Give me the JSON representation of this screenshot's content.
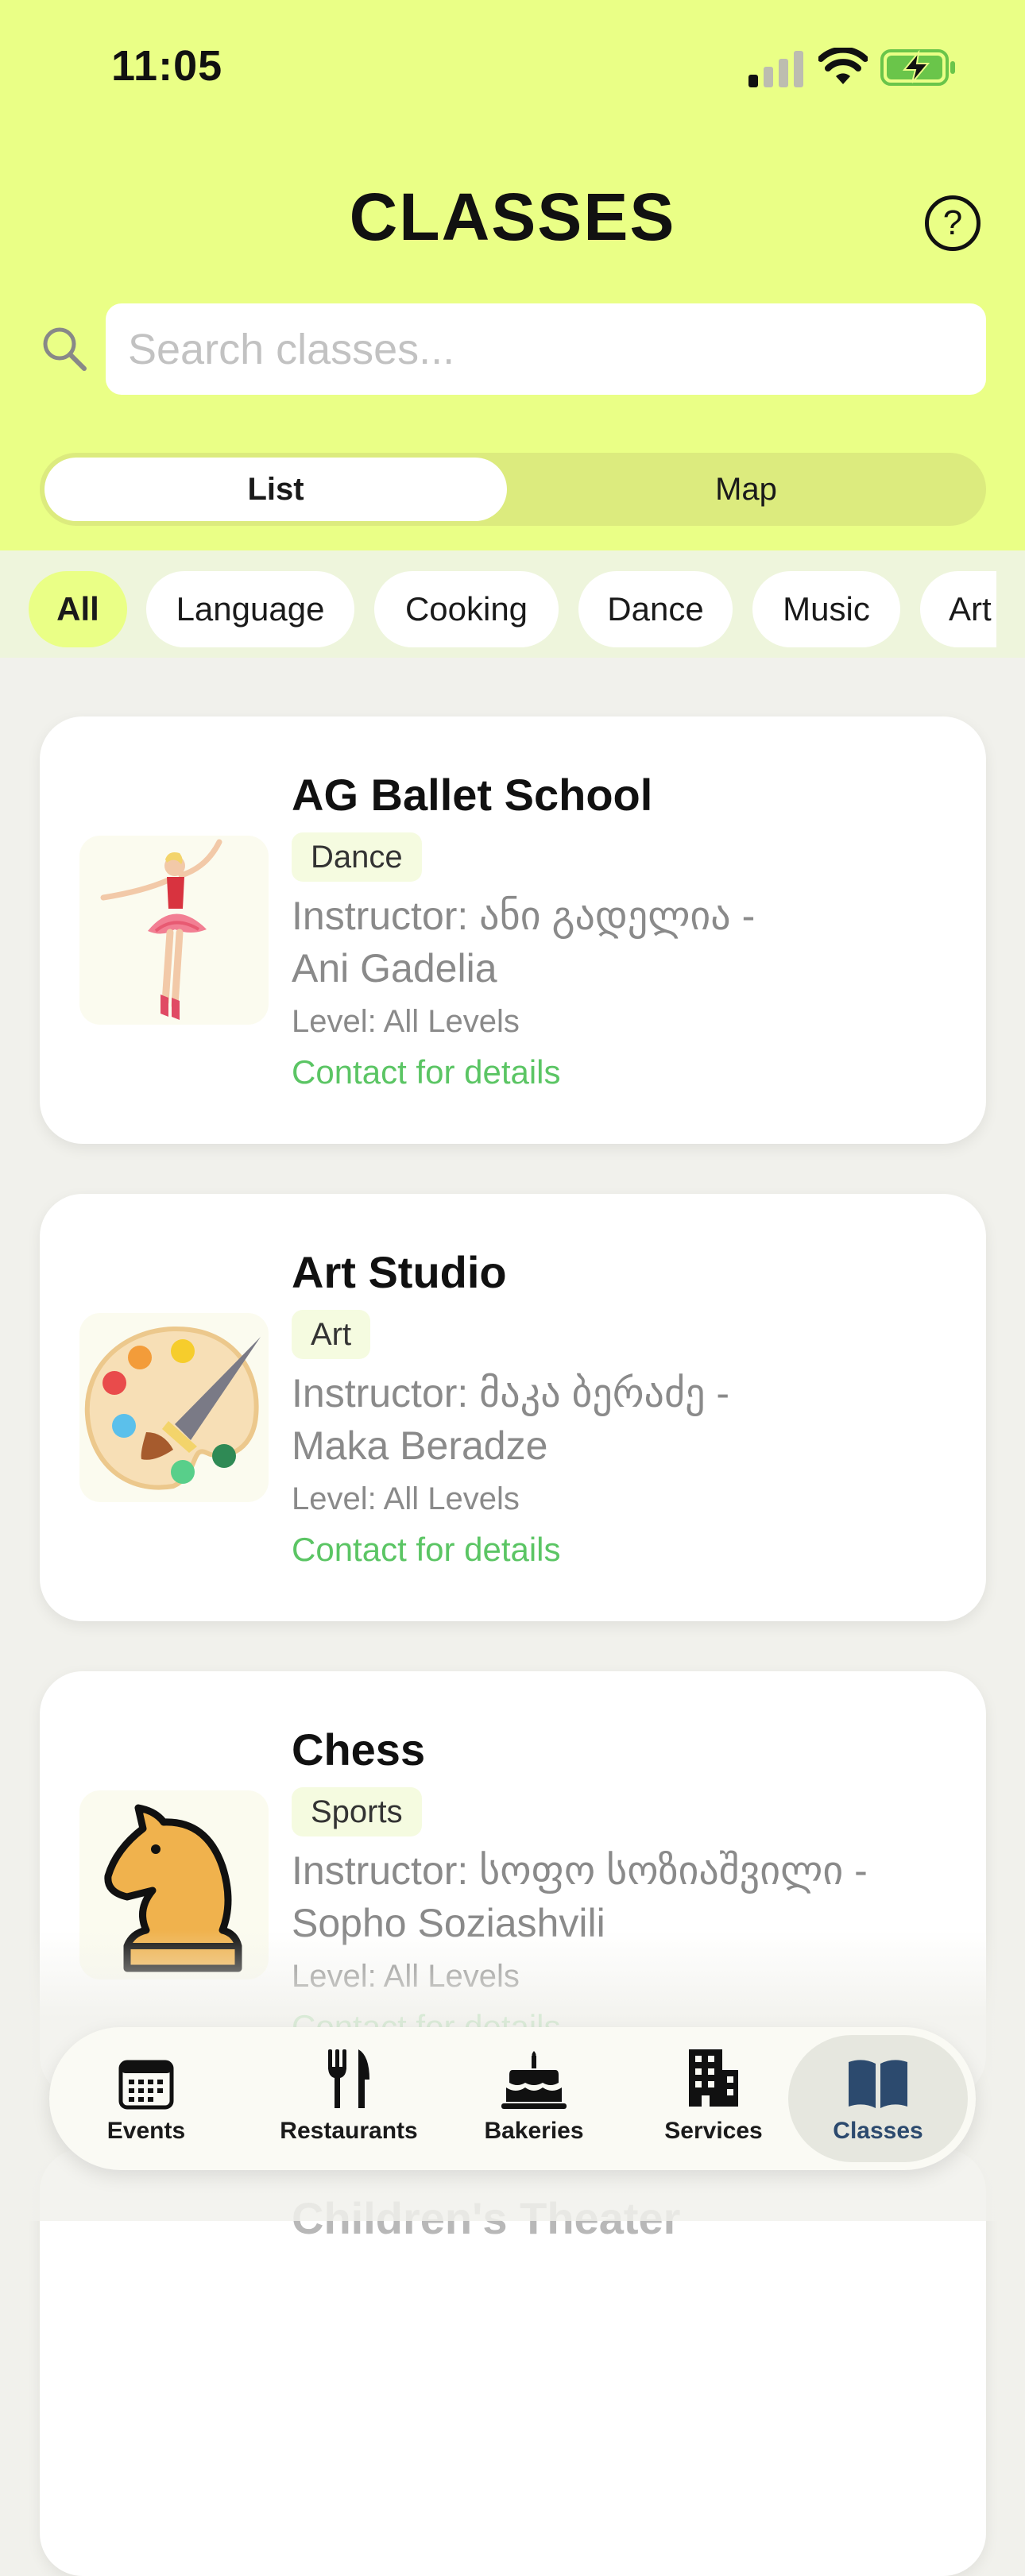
{
  "status_bar": {
    "time": "11:05"
  },
  "header": {
    "title": "CLASSES",
    "help_symbol": "?"
  },
  "search": {
    "placeholder": "Search classes...",
    "value": ""
  },
  "view_toggle": {
    "options": [
      "List",
      "Map"
    ],
    "selected": "List"
  },
  "filters": {
    "chips": [
      "All",
      "Language",
      "Cooking",
      "Dance",
      "Music",
      "Art"
    ],
    "selected": "All"
  },
  "classes": [
    {
      "title": "AG Ballet School",
      "category": "Dance",
      "instructor_line1": "Instructor: ანი გადელია -",
      "instructor_line2": "Ani Gadelia",
      "level": "Level: All Levels",
      "contact": "Contact for details",
      "icon": "ballerina-icon"
    },
    {
      "title": "Art Studio",
      "category": "Art",
      "instructor_line1": "Instructor: მაკა ბერაძე -",
      "instructor_line2": "Maka Beradze",
      "level": "Level: All Levels",
      "contact": "Contact for details",
      "icon": "palette-icon"
    },
    {
      "title": "Chess",
      "category": "Sports",
      "instructor_line1": "Instructor: სოფო სოზიაშვილი -",
      "instructor_line2": "Sopho Soziashvili",
      "level": "Level: All Levels",
      "contact": "Contact for details",
      "icon": "chess-knight-icon"
    },
    {
      "title": "Children's Theater"
    }
  ],
  "tab_bar": {
    "tabs": [
      {
        "label": "Events",
        "icon": "calendar-icon"
      },
      {
        "label": "Restaurants",
        "icon": "fork-knife-icon"
      },
      {
        "label": "Bakeries",
        "icon": "cake-icon"
      },
      {
        "label": "Services",
        "icon": "building-icon"
      },
      {
        "label": "Classes",
        "icon": "book-icon"
      }
    ],
    "selected": "Classes"
  },
  "colors": {
    "header_bg": "#eaff86",
    "accent_green_text": "#5bc564",
    "active_tab_icon": "#2c4a6e"
  }
}
